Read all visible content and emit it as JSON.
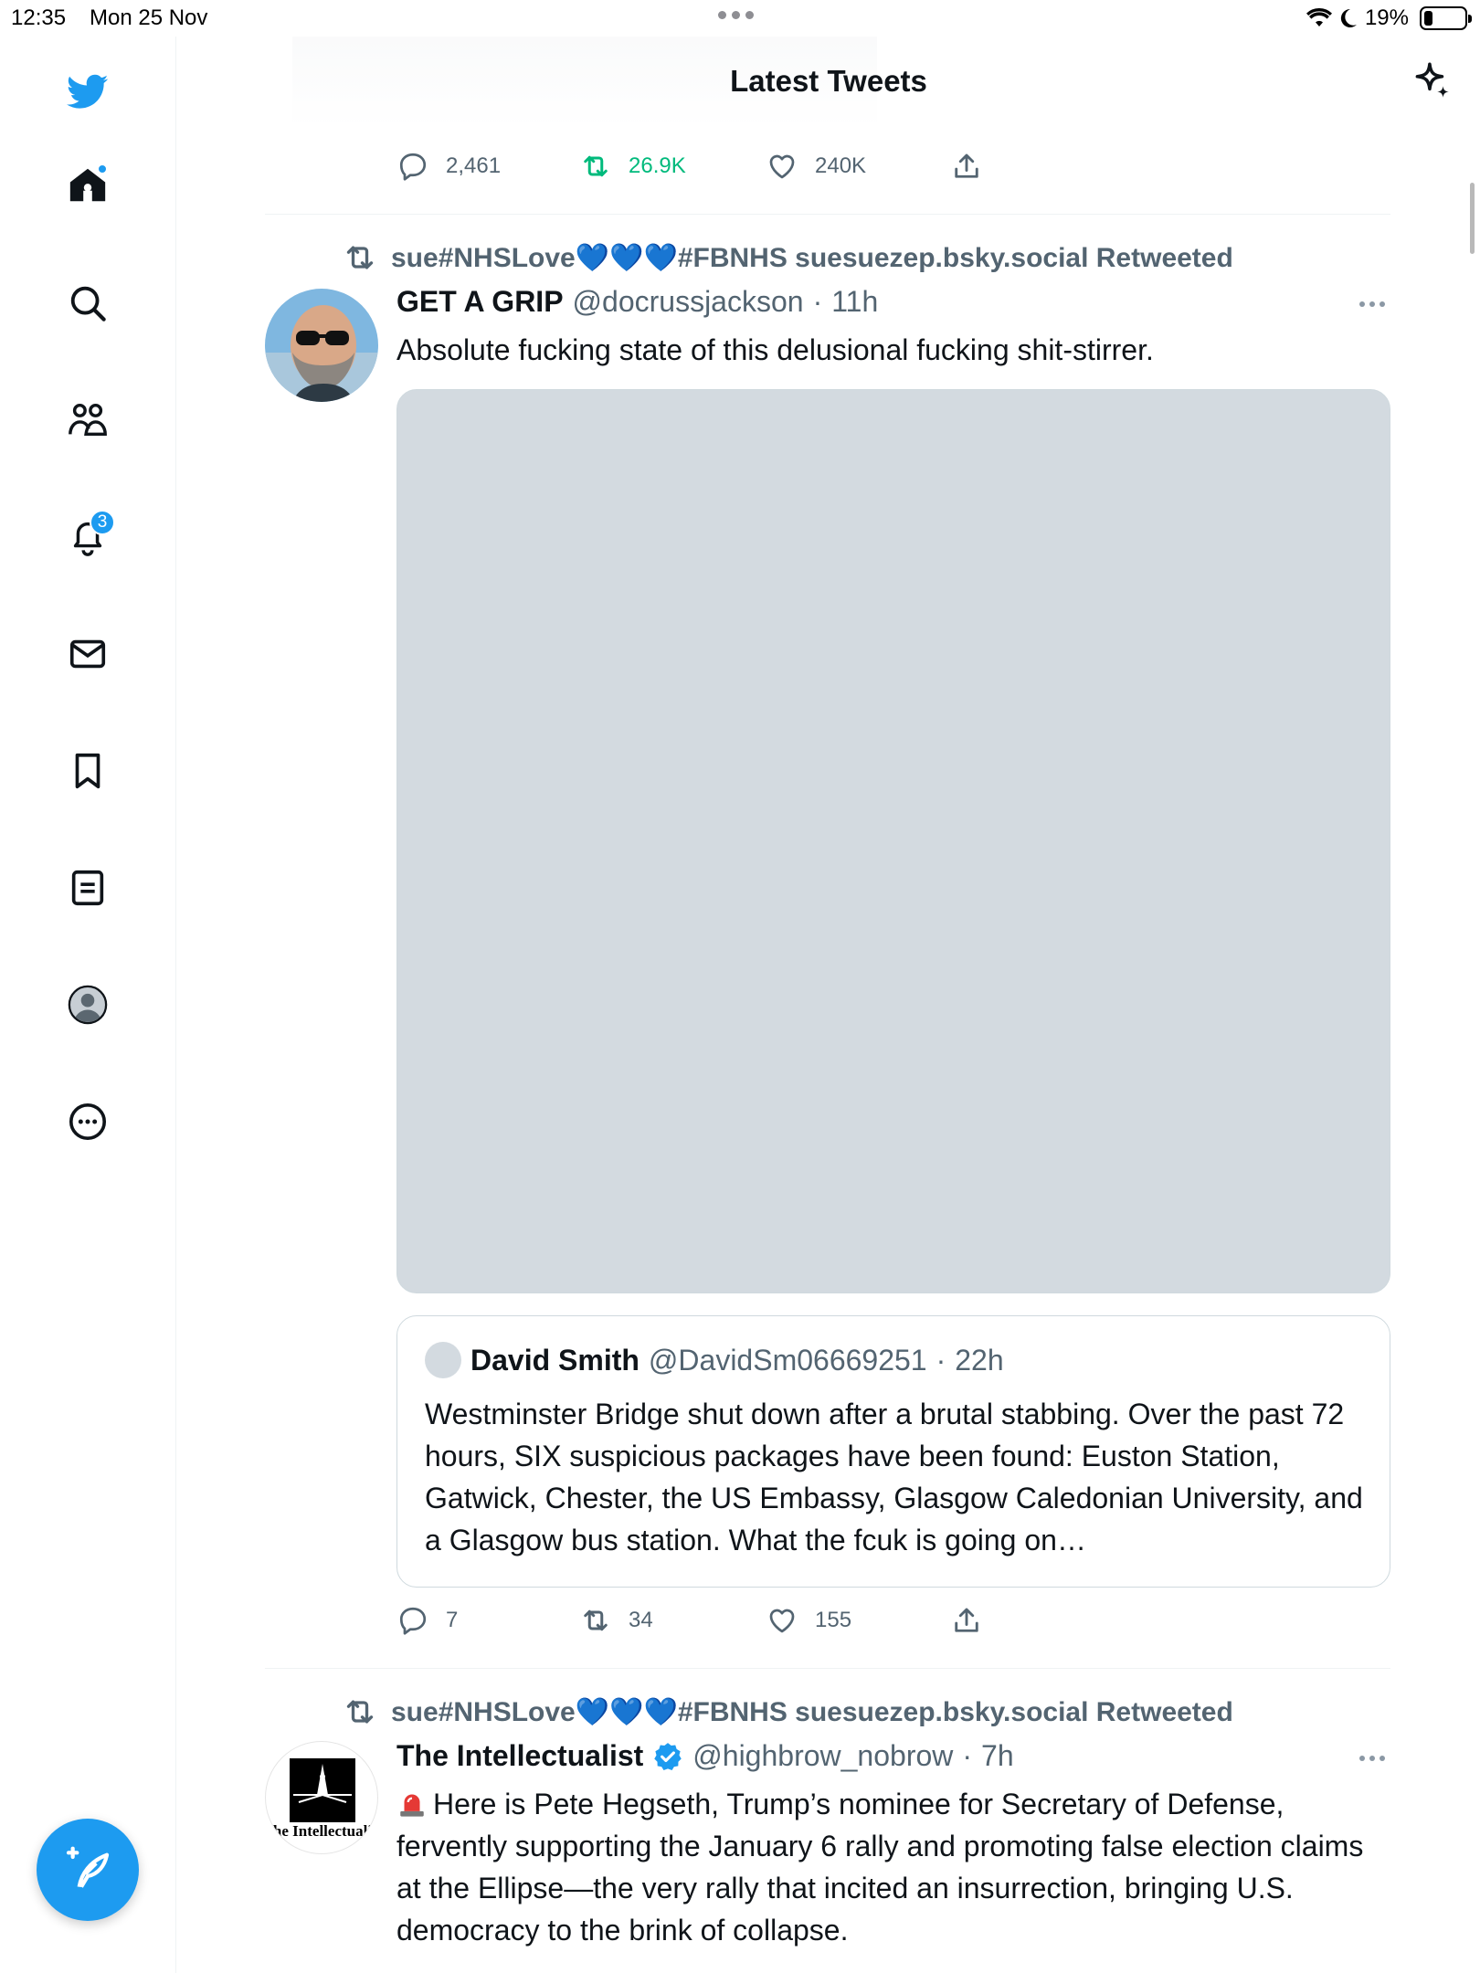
{
  "status_bar": {
    "time": "12:35",
    "date": "Mon 25 Nov",
    "battery_percent": "19%",
    "battery_level": 0.19
  },
  "header": {
    "title": "Latest Tweets",
    "sparkle_icon": "sparkle-icon"
  },
  "sidebar": {
    "items": [
      {
        "icon": "home-icon",
        "has_dot": true
      },
      {
        "icon": "search-icon"
      },
      {
        "icon": "communities-icon"
      },
      {
        "icon": "notifications-icon",
        "badge": "3"
      },
      {
        "icon": "messages-icon"
      },
      {
        "icon": "bookmarks-icon"
      },
      {
        "icon": "lists-icon"
      },
      {
        "icon": "profile-icon"
      },
      {
        "icon": "more-icon"
      }
    ],
    "compose_icon": "compose-icon"
  },
  "feed": {
    "prev_tweet_actions": {
      "replies": "2,461",
      "retweets": "26.9K",
      "likes": "240K",
      "retweet_color": "#00ba7c"
    },
    "tweets": [
      {
        "retweeted_by": "sue#NHSLove",
        "retweeted_by_suffix": "#FBNHS suesuezep.bsky.social Retweeted",
        "name": "GET A GRIP",
        "handle": "@docrussjackson",
        "time": "11h",
        "text": "Absolute fucking state of this delusional fucking shit-stirrer.",
        "quote": {
          "name": "David Smith",
          "handle": "@DavidSm06669251",
          "time": "22h",
          "text": "Westminster Bridge shut down after a brutal stabbing. Over the past 72 hours, SIX suspicious packages have been found: Euston Station, Gatwick, Chester, the US Embassy, Glasgow Caledonian University, and a Glasgow bus station. What the fcuk is going on…"
        },
        "actions": {
          "replies": "7",
          "retweets": "34",
          "likes": "155"
        }
      },
      {
        "retweeted_by": "sue#NHSLove",
        "retweeted_by_suffix": "#FBNHS suesuezep.bsky.social Retweeted",
        "name": "The Intellectualist",
        "verified": true,
        "handle": "@highbrow_nobrow",
        "time": "7h",
        "avatar_text": "he Intellectuali",
        "text": "Here is Pete Hegseth, Trump’s nominee for Secretary of Defense, fervently supporting the January 6 rally and promoting false election claims at the Ellipse—the very rally that incited an insurrection, bringing U.S. democracy to the brink of collapse."
      }
    ]
  },
  "colors": {
    "accent": "#1d9bf0",
    "secondary_text": "#536471",
    "media_placeholder": "#d3dae0",
    "heart_emoji": "#1877f2"
  }
}
